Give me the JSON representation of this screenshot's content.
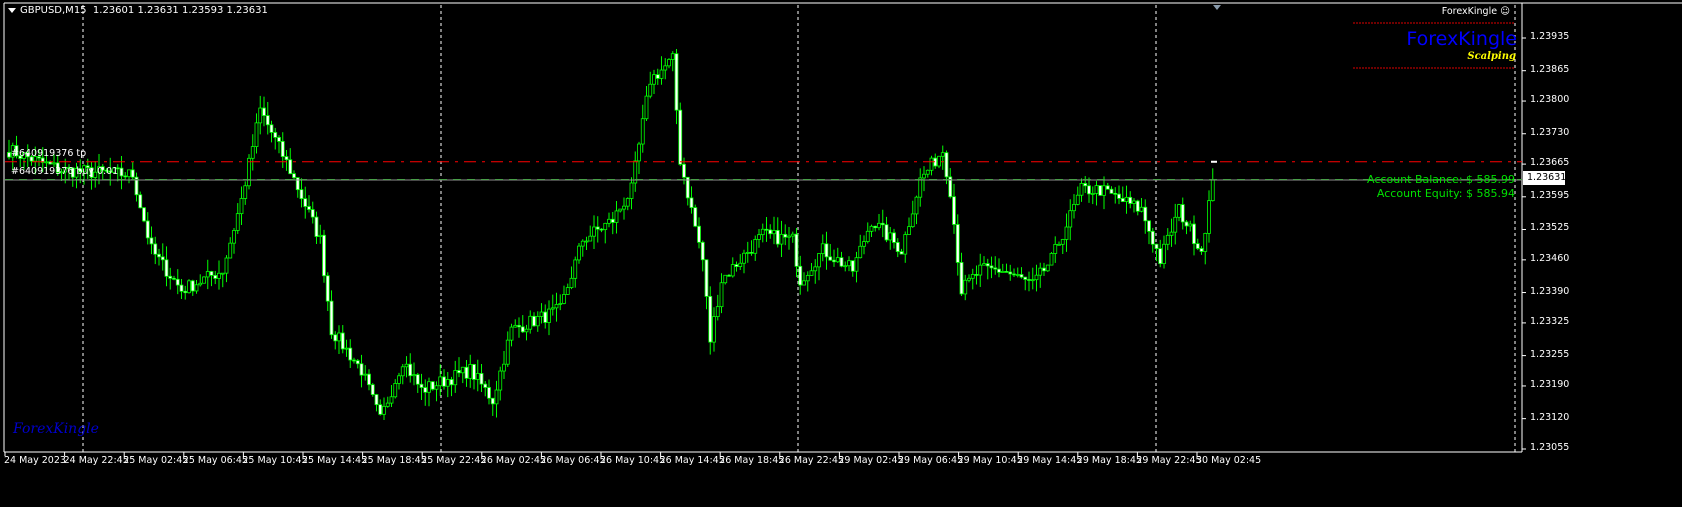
{
  "header": {
    "symbol": "GBPUSD,M15",
    "ohlc": "1.23601 1.23631 1.23593 1.23631"
  },
  "trades": {
    "tp_label": "#640919376 tp",
    "buy_label": "#640919376 buy 0.01"
  },
  "indicator": {
    "name": "ForexKingle",
    "logo_text": "ForexKingle",
    "logo_sub": "Scalping",
    "watermark": "ForexKingle",
    "account_balance": "Account Balance: $ 585.99",
    "account_equity": "Account Equity: $ 585.94"
  },
  "price_axis": {
    "ticks": [
      "1.23935",
      "1.23865",
      "1.23800",
      "1.23730",
      "1.23665",
      "1.23595",
      "1.23525",
      "1.23460",
      "1.23390",
      "1.23325",
      "1.23255",
      "1.23190",
      "1.23120",
      "1.23055"
    ],
    "current": "1.23631"
  },
  "time_axis": {
    "ticks": [
      "24 May 2023",
      "24 May 22:45",
      "25 May 02:45",
      "25 May 06:45",
      "25 May 10:45",
      "25 May 14:45",
      "25 May 18:45",
      "25 May 22:45",
      "26 May 02:45",
      "26 May 06:45",
      "26 May 10:45",
      "26 May 14:45",
      "26 May 18:45",
      "26 May 22:45",
      "29 May 02:45",
      "29 May 06:45",
      "29 May 10:45",
      "29 May 14:45",
      "29 May 18:45",
      "29 May 22:45",
      "30 May 02:45"
    ]
  },
  "colors": {
    "bg": "#000000",
    "candle": "#00ff00",
    "tp_line": "#ff0000",
    "bid_line": "#808080",
    "open_line": "#00c000"
  },
  "chart_data": {
    "type": "candlestick",
    "price_range": [
      1.2302,
      1.2398
    ],
    "tp_price": 1.2367,
    "current_price": 1.23631,
    "bars": 322,
    "close_path": [
      [
        0,
        1.23695
      ],
      [
        14,
        1.23652
      ],
      [
        33,
        1.23642
      ],
      [
        38,
        1.23481
      ],
      [
        46,
        1.23395
      ],
      [
        57,
        1.23438
      ],
      [
        62,
        1.23588
      ],
      [
        67,
        1.23781
      ],
      [
        75,
        1.23652
      ],
      [
        83,
        1.23503
      ],
      [
        86,
        1.2331
      ],
      [
        94,
        1.23224
      ],
      [
        99,
        1.23117
      ],
      [
        105,
        1.23246
      ],
      [
        110,
        1.23181
      ],
      [
        123,
        1.23224
      ],
      [
        129,
        1.2316
      ],
      [
        134,
        1.2331
      ],
      [
        147,
        1.23353
      ],
      [
        153,
        1.23503
      ],
      [
        161,
        1.23545
      ],
      [
        166,
        1.2361
      ],
      [
        171,
        1.23845
      ],
      [
        177,
        1.23888
      ],
      [
        179,
        1.23674
      ],
      [
        185,
        1.2346
      ],
      [
        187,
        1.23288
      ],
      [
        190,
        1.23417
      ],
      [
        201,
        1.23513
      ],
      [
        209,
        1.23503
      ],
      [
        211,
        1.23417
      ],
      [
        217,
        1.23481
      ],
      [
        225,
        1.23438
      ],
      [
        230,
        1.23545
      ],
      [
        238,
        1.23481
      ],
      [
        243,
        1.23631
      ],
      [
        249,
        1.23695
      ],
      [
        251,
        1.2361
      ],
      [
        254,
        1.23395
      ],
      [
        259,
        1.23438
      ],
      [
        265,
        1.23438
      ],
      [
        273,
        1.23406
      ],
      [
        278,
        1.2346
      ],
      [
        286,
        1.2361
      ],
      [
        291,
        1.2361
      ],
      [
        302,
        1.23567
      ],
      [
        307,
        1.2346
      ],
      [
        312,
        1.23567
      ],
      [
        318,
        1.23481
      ],
      [
        321,
        1.23631
      ]
    ]
  }
}
